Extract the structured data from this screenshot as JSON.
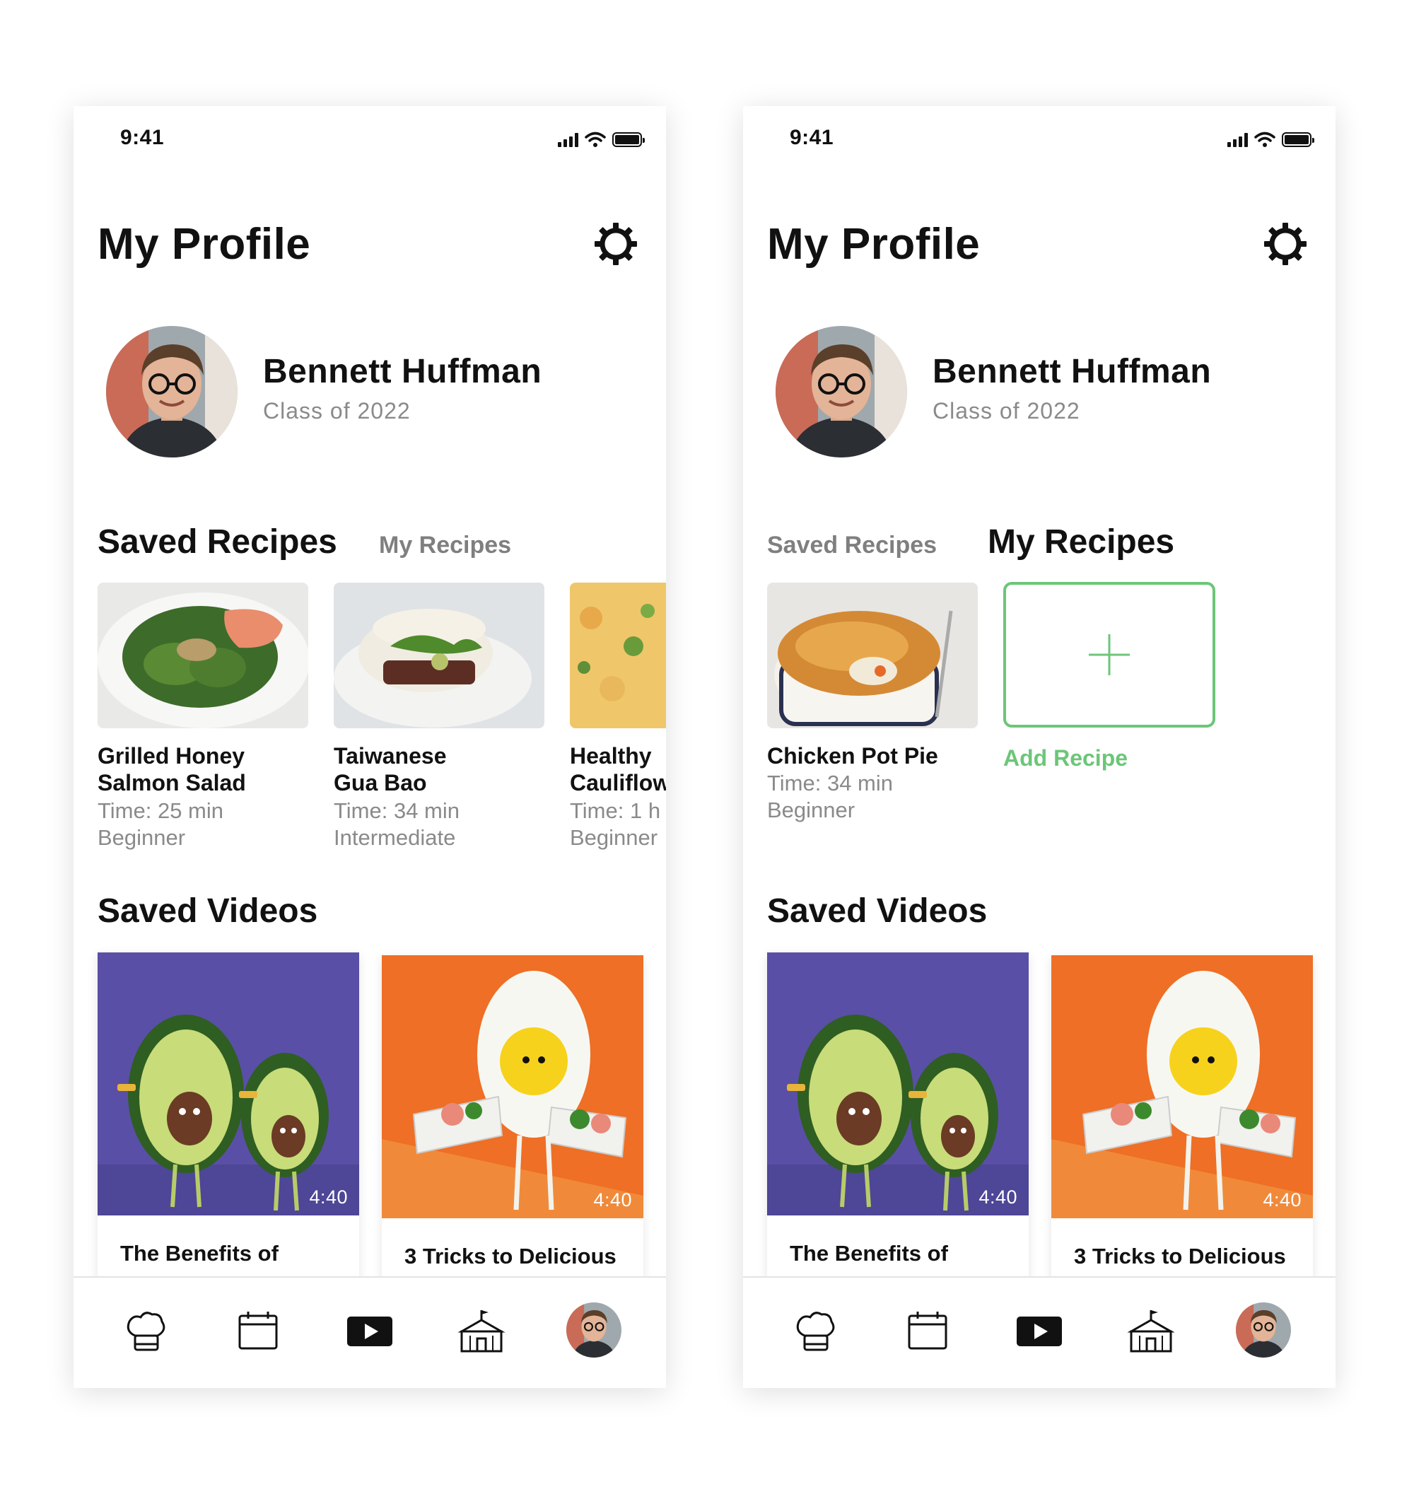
{
  "status_bar": {
    "time": "9:41"
  },
  "header": {
    "title": "My Profile"
  },
  "profile": {
    "name": "Bennett Huffman",
    "subtitle": "Class of 2022"
  },
  "tabs": {
    "saved": "Saved Recipes",
    "mine": "My Recipes"
  },
  "saved_recipes": [
    {
      "title_line1": "Grilled Honey",
      "title_line2": "Salmon Salad",
      "time": "Time: 25 min",
      "level": "Beginner"
    },
    {
      "title_line1": "Taiwanese",
      "title_line2": "Gua Bao",
      "time": "Time: 34 min",
      "level": "Intermediate"
    },
    {
      "title_line1": "Healthy",
      "title_line2": "Cauliflow",
      "time": "Time: 1 h",
      "level": "Beginner"
    }
  ],
  "my_recipes": [
    {
      "title": "Chicken Pot Pie",
      "time": "Time: 34 min",
      "level": "Beginner"
    }
  ],
  "add_recipe_label": "Add Recipe",
  "saved_videos": {
    "title": "Saved Videos",
    "items": [
      {
        "title": "The Benefits of",
        "duration": "4:40"
      },
      {
        "title": "3 Tricks to Delicious",
        "duration": "4:40"
      }
    ]
  },
  "bottom_nav": {
    "items": [
      "chef-hat-icon",
      "calendar-icon",
      "video-play-icon",
      "school-icon",
      "profile-avatar"
    ],
    "active": "video-play-icon"
  },
  "colors": {
    "accent_green": "#6cc678",
    "video_purple": "#5a4fa6",
    "video_orange": "#ee6f25",
    "muted_text": "#8a8a8a"
  }
}
